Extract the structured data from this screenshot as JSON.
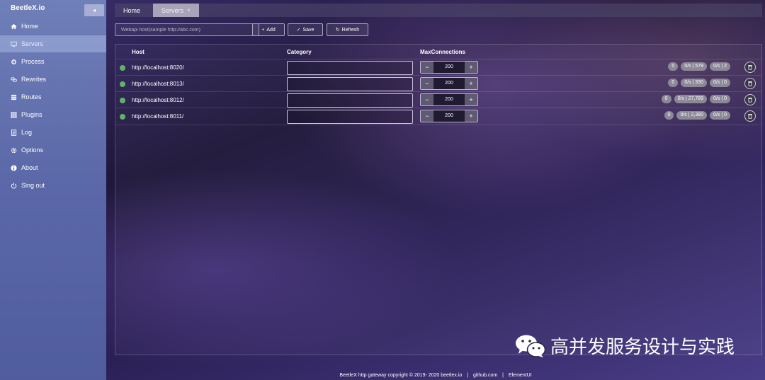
{
  "app": {
    "brand": "BeetleX.io",
    "collapse_icon": "◂"
  },
  "sidebar": {
    "items": [
      {
        "label": "Home",
        "icon": "home-icon",
        "active": false
      },
      {
        "label": "Servers",
        "icon": "monitor-icon",
        "active": true
      },
      {
        "label": "Process",
        "icon": "cog-icon",
        "active": false
      },
      {
        "label": "Rewrites",
        "icon": "link-icon",
        "active": false
      },
      {
        "label": "Routes",
        "icon": "routes-icon",
        "active": false
      },
      {
        "label": "Plugins",
        "icon": "grid-icon",
        "active": false
      },
      {
        "label": "Log",
        "icon": "document-icon",
        "active": false
      },
      {
        "label": "Options",
        "icon": "gear-icon",
        "active": false
      },
      {
        "label": "About",
        "icon": "info-icon",
        "active": false
      },
      {
        "label": "Sing out",
        "icon": "power-icon",
        "active": false
      }
    ]
  },
  "tabs": [
    {
      "label": "Home",
      "active": false
    },
    {
      "label": "Servers",
      "active": true,
      "close": "×"
    }
  ],
  "toolbar": {
    "search_placeholder": "Webapi host(sample http://abc.com)",
    "search_value": "",
    "add_label": "Add",
    "add_icon": "+",
    "save_label": "Save",
    "save_icon": "✓",
    "refresh_label": "Refresh",
    "refresh_icon": "↻"
  },
  "table": {
    "headers": {
      "host": "Host",
      "category": "Category",
      "max": "MaxConnections"
    },
    "rows": [
      {
        "host": "http://localhost:8020/",
        "category": "",
        "max": "200",
        "badges": [
          "0",
          "0/s | 579",
          "0/s | 2"
        ]
      },
      {
        "host": "http://localhost:8013/",
        "category": "",
        "max": "200",
        "badges": [
          "0",
          "0/s | 330",
          "0/s | 0"
        ]
      },
      {
        "host": "http://localhost:8012/",
        "category": "",
        "max": "200",
        "badges": [
          "0",
          "0/s | 27,789",
          "0/s | 0"
        ]
      },
      {
        "host": "http://localhost:8011/",
        "category": "",
        "max": "200",
        "badges": [
          "0",
          "0/s | 2,380",
          "0/s | 0"
        ]
      }
    ],
    "minus": "−",
    "plus": "+"
  },
  "footer": {
    "copyright": "BeetleX http gateway copyright © 2019- 2020 beetlex.io",
    "sep": "|",
    "github": "github.com",
    "elementui": "ElementUI"
  },
  "watermark": {
    "text": "高并发服务设计与实践"
  },
  "colors": {
    "status_ok": "#5fb36a",
    "sidebar": "#5a67a8",
    "active_tab": "#a8a3b8"
  }
}
